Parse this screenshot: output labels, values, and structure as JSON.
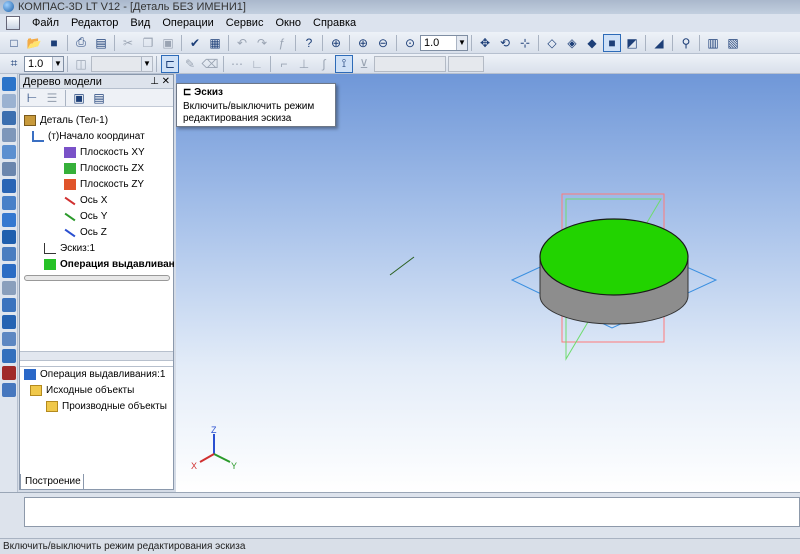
{
  "window": {
    "title": "КОМПАС-3D LT V12 - [Деталь БЕЗ ИМЕНИ1]"
  },
  "menu": [
    "Файл",
    "Редактор",
    "Вид",
    "Операции",
    "Сервис",
    "Окно",
    "Справка"
  ],
  "toolbar": {
    "zoom_value": "1.0",
    "step_value": "1.0"
  },
  "model_tree": {
    "header": "Дерево модели",
    "nodes": [
      "Деталь (Тел-1)",
      "(т)Начало координат",
      "Плоскость XY",
      "Плоскость ZX",
      "Плоскость ZY",
      "Ось X",
      "Ось Y",
      "Ось Z",
      "Эскиз:1",
      "Операция выдавливан"
    ],
    "relations": [
      "Операция выдавливания:1",
      "Исходные объекты",
      "Производные объекты"
    ],
    "tab": "Построение"
  },
  "tooltip": {
    "title": "Эскиз",
    "text": "Включить/выключить режим редактирования эскиза"
  },
  "axes": {
    "x": "X",
    "y": "Y",
    "z": "Z"
  },
  "colors": {
    "top_face": "#22d300",
    "plane_zx": "#ff7a7a",
    "plane_zy": "#6fdc6f",
    "plane_xy": "#3a8fe0"
  },
  "status": {
    "text": "Включить/выключить режим редактирования эскиза"
  }
}
